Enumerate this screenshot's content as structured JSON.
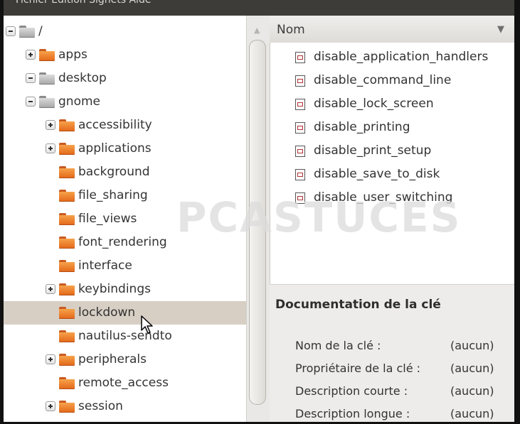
{
  "menubar": {
    "partial_text": "Fichier  Édition  Signets  Aide"
  },
  "tree": {
    "rows": [
      {
        "label": "/",
        "expander": "minus",
        "folder": "grey",
        "depth": 0
      },
      {
        "label": "apps",
        "expander": "plus",
        "folder": "orange",
        "depth": 1
      },
      {
        "label": "desktop",
        "expander": "minus",
        "folder": "grey",
        "depth": 1
      },
      {
        "label": "gnome",
        "expander": "minus",
        "folder": "grey",
        "depth": 2
      },
      {
        "label": "accessibility",
        "expander": "plus",
        "folder": "orange",
        "depth": 3
      },
      {
        "label": "applications",
        "expander": "plus",
        "folder": "orange",
        "depth": 3
      },
      {
        "label": "background",
        "expander": "",
        "folder": "orange",
        "depth": 3
      },
      {
        "label": "file_sharing",
        "expander": "",
        "folder": "orange",
        "depth": 3
      },
      {
        "label": "file_views",
        "expander": "",
        "folder": "orange",
        "depth": 3
      },
      {
        "label": "font_rendering",
        "expander": "",
        "folder": "orange",
        "depth": 3
      },
      {
        "label": "interface",
        "expander": "",
        "folder": "orange",
        "depth": 3
      },
      {
        "label": "keybindings",
        "expander": "plus",
        "folder": "orange",
        "depth": 3
      },
      {
        "label": "lockdown",
        "expander": "",
        "folder": "orange",
        "depth": 3,
        "selected": true
      },
      {
        "label": "nautilus-sendto",
        "expander": "",
        "folder": "orange",
        "depth": 3
      },
      {
        "label": "peripherals",
        "expander": "plus",
        "folder": "orange",
        "depth": 3
      },
      {
        "label": "remote_access",
        "expander": "",
        "folder": "orange",
        "depth": 3
      },
      {
        "label": "session",
        "expander": "plus",
        "folder": "orange",
        "depth": 3
      }
    ]
  },
  "list": {
    "column_header": "Nom",
    "items": [
      "disable_application_handlers",
      "disable_command_line",
      "disable_lock_screen",
      "disable_printing",
      "disable_print_setup",
      "disable_save_to_disk",
      "disable_user_switching"
    ]
  },
  "watermark": "PCASTUCES",
  "documentation": {
    "title": "Documentation de la clé",
    "fields": [
      {
        "key": "Nom de la clé :",
        "value": "(aucun)"
      },
      {
        "key": "Propriétaire de la clé :",
        "value": "(aucun)"
      },
      {
        "key": "Description courte :",
        "value": "(aucun)"
      },
      {
        "key": "Description longue :",
        "value": "(aucun)"
      }
    ]
  },
  "colors": {
    "selection": "#d7cfc4",
    "folder_orange": "#e46b1c",
    "menubar": "#3d3c38"
  }
}
